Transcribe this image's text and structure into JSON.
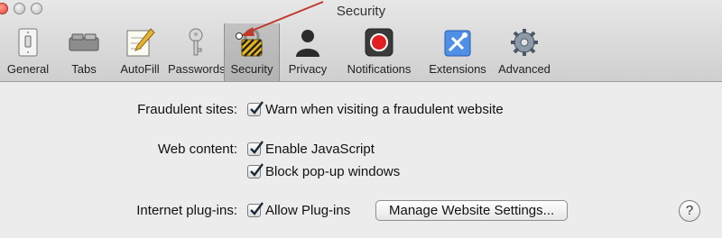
{
  "window": {
    "title": "Security"
  },
  "tabs": [
    {
      "label": "General",
      "icon": "light-switch-icon"
    },
    {
      "label": "Tabs",
      "icon": "tabs-icon"
    },
    {
      "label": "AutoFill",
      "icon": "autofill-pencil-icon"
    },
    {
      "label": "Passwords",
      "icon": "key-icon"
    },
    {
      "label": "Security",
      "icon": "security-lock-icon",
      "selected": true
    },
    {
      "label": "Privacy",
      "icon": "privacy-person-icon"
    },
    {
      "label": "Notifications",
      "icon": "notifications-record-icon"
    },
    {
      "label": "Extensions",
      "icon": "extensions-puzzle-icon"
    },
    {
      "label": "Advanced",
      "icon": "gear-icon"
    }
  ],
  "security": {
    "fraudulent": {
      "label": "Fraudulent sites:",
      "option": "Warn when visiting a fraudulent website",
      "checked": true
    },
    "web_content": {
      "label": "Web content:",
      "javascript": {
        "option": "Enable JavaScript",
        "checked": true
      },
      "popups": {
        "option": "Block pop-up windows",
        "checked": true
      }
    },
    "plugins": {
      "label": "Internet plug-ins:",
      "option": "Allow Plug-ins",
      "checked": true,
      "manage_button": "Manage Website Settings..."
    },
    "help": "?"
  },
  "colors": {
    "annotation_arrow": "#c0392b",
    "accent_blue": "#2f6fd6",
    "record_red": "#e02020"
  }
}
